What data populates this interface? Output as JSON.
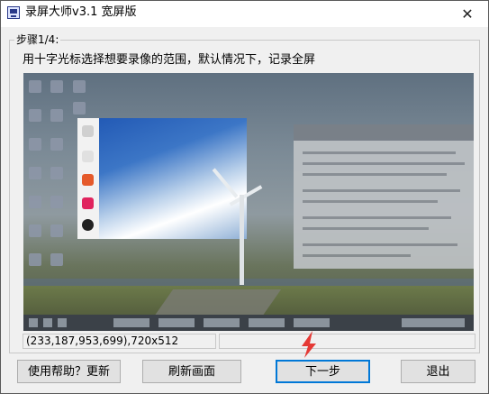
{
  "window": {
    "title": "录屏大师v3.1 宽屏版",
    "close_glyph": "✕"
  },
  "group": {
    "legend": "步骤1/4:",
    "instruction": "用十字光标选择想要录像的范围，默认情况下，记录全屏"
  },
  "status": {
    "region": "(233,187,953,699),720x512",
    "extra": ""
  },
  "buttons": {
    "help": "使用帮助？更新",
    "refresh": "刷新画面",
    "next": "下一步",
    "exit": "退出"
  },
  "colors": {
    "accent": "#0078d7",
    "cursor": "#e53935"
  }
}
